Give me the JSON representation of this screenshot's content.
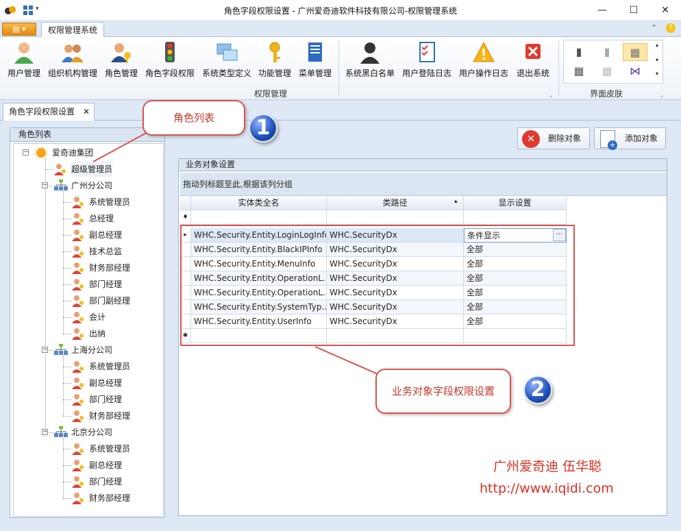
{
  "window": {
    "title": "角色字段权限设置 - 广州爱奇迪软件科技有限公司-权限管理系统"
  },
  "ribbon": {
    "tab": "权限管理系统",
    "buttons": [
      {
        "label": "用户管理",
        "icon": "user-icon"
      },
      {
        "label": "组织机构管理",
        "icon": "org-users-icon"
      },
      {
        "label": "角色管理",
        "icon": "role-key-icon"
      },
      {
        "label": "角色字段权限",
        "icon": "traffic-light-icon"
      },
      {
        "label": "系统类型定义",
        "icon": "system-type-icon"
      },
      {
        "label": "功能管理",
        "icon": "key-icon"
      },
      {
        "label": "菜单管理",
        "icon": "menu-book-icon"
      },
      {
        "label": "系统黑白名单",
        "icon": "silhouette-icon"
      },
      {
        "label": "用户登陆日志",
        "icon": "checklist-icon"
      },
      {
        "label": "用户操作日志",
        "icon": "warning-icon"
      },
      {
        "label": "退出系统",
        "icon": "exit-x-icon"
      }
    ],
    "group_label": "权限管理",
    "skin_label": "界面皮肤"
  },
  "doc_tab": {
    "label": "角色字段权限设置"
  },
  "left_panel": {
    "header": "角色列表",
    "tree": [
      {
        "label": "爱奇迪集团",
        "level": 0,
        "kind": "root"
      },
      {
        "label": "超级管理员",
        "level": 1,
        "kind": "role"
      },
      {
        "label": "广州分公司",
        "level": 1,
        "kind": "branch"
      },
      {
        "label": "系统管理员",
        "level": 2,
        "kind": "role"
      },
      {
        "label": "总经理",
        "level": 2,
        "kind": "role"
      },
      {
        "label": "副总经理",
        "level": 2,
        "kind": "role"
      },
      {
        "label": "技术总监",
        "level": 2,
        "kind": "role"
      },
      {
        "label": "财务部经理",
        "level": 2,
        "kind": "role"
      },
      {
        "label": "部门经理",
        "level": 2,
        "kind": "role"
      },
      {
        "label": "部门副经理",
        "level": 2,
        "kind": "role"
      },
      {
        "label": "会计",
        "level": 2,
        "kind": "role"
      },
      {
        "label": "出纳",
        "level": 2,
        "kind": "role"
      },
      {
        "label": "上海分公司",
        "level": 1,
        "kind": "branch"
      },
      {
        "label": "系统管理员",
        "level": 2,
        "kind": "role"
      },
      {
        "label": "副总经理",
        "level": 2,
        "kind": "role"
      },
      {
        "label": "部门经理",
        "level": 2,
        "kind": "role"
      },
      {
        "label": "财务部经理",
        "level": 2,
        "kind": "role"
      },
      {
        "label": "北京分公司",
        "level": 1,
        "kind": "branch"
      },
      {
        "label": "系统管理员",
        "level": 2,
        "kind": "role"
      },
      {
        "label": "副总经理",
        "level": 2,
        "kind": "role"
      },
      {
        "label": "部门经理",
        "level": 2,
        "kind": "role"
      },
      {
        "label": "财务部经理",
        "level": 2,
        "kind": "role"
      }
    ]
  },
  "actions": {
    "delete": "删除对象",
    "add": "添加对象"
  },
  "group": {
    "title": "业务对象设置",
    "group_hint": "拖动列标题至此,根据该列分组",
    "columns": [
      "实体类全名",
      "类路径",
      "显示设置"
    ],
    "rows": [
      [
        "WHC.Security.Entity.LoginLogInfo",
        "WHC.SecurityDx",
        "条件显示"
      ],
      [
        "WHC.Security.Entity.BlackIPInfo",
        "WHC.SecurityDx",
        "全部"
      ],
      [
        "WHC.Security.Entity.MenuInfo",
        "WHC.SecurityDx",
        "全部"
      ],
      [
        "WHC.Security.Entity.OperationL...",
        "WHC.SecurityDx",
        "全部"
      ],
      [
        "WHC.Security.Entity.OperationL...",
        "WHC.SecurityDx",
        "全部"
      ],
      [
        "WHC.Security.Entity.SystemTyp...",
        "WHC.SecurityDx",
        "全部"
      ],
      [
        "WHC.Security.Entity.UserInfo",
        "WHC.SecurityDx",
        "全部"
      ]
    ]
  },
  "annotations": {
    "callout1": "角色列表",
    "callout2": "业务对象字段权限设置",
    "num1": "1",
    "num2": "2",
    "watermark_name": "广州爱奇迪 伍华聪",
    "watermark_url": "http://www.iqidi.com"
  },
  "colors": {
    "accent": "#d9534f",
    "badge": "#1f4fb8",
    "panel": "#dfe8f5"
  }
}
